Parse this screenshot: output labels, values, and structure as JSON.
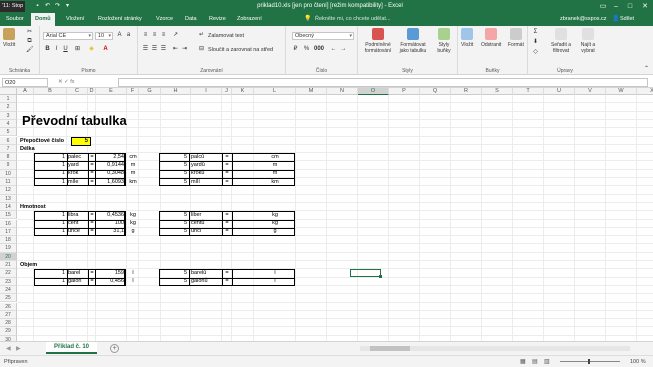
{
  "titlebar": {
    "badge": "'11: Stop",
    "title": "priklad10.xls  [jen pro čtení]  [režim kompatibility]  - Excel",
    "minimize": "–",
    "maximize": "□",
    "close": "✕"
  },
  "tabs": [
    "Soubor",
    "Domů",
    "Vložení",
    "Rozložení stránky",
    "Vzorce",
    "Data",
    "Revize",
    "Zobrazení"
  ],
  "tellme": "Řekněte mi, co chcete udělat...",
  "user": "zbranek@sspos.cz",
  "share": "Sdílet",
  "ribbon": {
    "paste": "Vložit",
    "font_name": "Arial CE",
    "font_size": "10",
    "wrap_text": "Zalamovat text",
    "merge": "Sloučit a zarovnat na střed",
    "number_format": "Obecný",
    "cond_format": "Podmíněné formátování",
    "format_table": "Formátovat jako tabulku",
    "styles": "Styly buňky",
    "insert": "Vložit",
    "delete": "Odstranit",
    "format": "Formát",
    "sort": "Seřadit a filtrovat",
    "find": "Najít a vybrat",
    "groups": [
      "Schránka",
      "Písmo",
      "Zarovnání",
      "Číslo",
      "Styly",
      "Buňky",
      "Úpravy"
    ]
  },
  "formula": {
    "namebox": "O20",
    "fx": "✕  ✓  fx",
    "value": ""
  },
  "columns": [
    "A",
    "B",
    "C",
    "D",
    "E",
    "F",
    "G",
    "H",
    "I",
    "J",
    "K",
    "L",
    "M",
    "N",
    "O",
    "P",
    "Q",
    "R",
    "S",
    "T",
    "U",
    "V",
    "W",
    "X"
  ],
  "rows": [
    "1",
    "2",
    "3",
    "4",
    "5",
    "6",
    "7",
    "8",
    "9",
    "10",
    "11",
    "12",
    "13",
    "14",
    "15",
    "16",
    "17",
    "18",
    "19",
    "20",
    "21",
    "22",
    "23",
    "24",
    "25",
    "26",
    "27",
    "28",
    "29",
    "30"
  ],
  "sheet": {
    "title": "Převodní tabulka",
    "input_label": "Přepočtové číslo",
    "input_value": "5",
    "sections": [
      {
        "name": "Délka",
        "rows": [
          {
            "qty": "1",
            "unit": "palec",
            "eq": "=",
            "val": "2,54",
            "vunit": "cm",
            "n": "5",
            "unit2": "palců",
            "eq2": "=",
            "res": "",
            "runit": "cm"
          },
          {
            "qty": "1",
            "unit": "yard",
            "eq": "=",
            "val": "0,9144",
            "vunit": "m",
            "n": "5",
            "unit2": "yardů",
            "eq2": "=",
            "res": "",
            "runit": "m"
          },
          {
            "qty": "1",
            "unit": "krok",
            "eq": "=",
            "val": "0,3048",
            "vunit": "m",
            "n": "5",
            "unit2": "kroků",
            "eq2": "=",
            "res": "",
            "runit": "m"
          },
          {
            "qty": "1",
            "unit": "míle",
            "eq": "=",
            "val": "1,6093",
            "vunit": "km",
            "n": "5",
            "unit2": "mílí",
            "eq2": "=",
            "res": "",
            "runit": "km"
          }
        ]
      },
      {
        "name": "Hmotnost",
        "rows": [
          {
            "qty": "1",
            "unit": "libra",
            "eq": "=",
            "val": "0,4536",
            "vunit": "kg",
            "n": "5",
            "unit2": "liber",
            "eq2": "=",
            "res": "",
            "runit": "kg"
          },
          {
            "qty": "1",
            "unit": "cent",
            "eq": "=",
            "val": "100",
            "vunit": "kg",
            "n": "5",
            "unit2": "centů",
            "eq2": "=",
            "res": "",
            "runit": "kg"
          },
          {
            "qty": "1",
            "unit": "unce",
            "eq": "=",
            "val": "31,1",
            "vunit": "g",
            "n": "5",
            "unit2": "uncí",
            "eq2": "=",
            "res": "",
            "runit": "g"
          }
        ]
      },
      {
        "name": "Objem",
        "rows": [
          {
            "qty": "1",
            "unit": "barel",
            "eq": "=",
            "val": "159",
            "vunit": "l",
            "n": "5",
            "unit2": "barelů",
            "eq2": "=",
            "res": "",
            "runit": "l"
          },
          {
            "qty": "1",
            "unit": "galon",
            "eq": "=",
            "val": "0,456",
            "vunit": "l",
            "n": "5",
            "unit2": "galonů",
            "eq2": "=",
            "res": "",
            "runit": "l"
          }
        ]
      }
    ]
  },
  "sheet_tab": "Příklad č. 10",
  "status": "Připraven",
  "zoom": "100 %",
  "colors": {
    "accent": "#217346",
    "highlight": "#ffff00"
  }
}
